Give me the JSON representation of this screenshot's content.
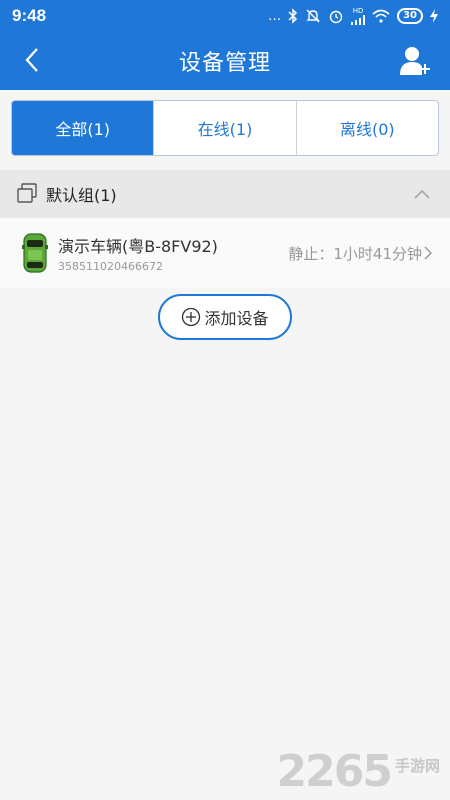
{
  "status_bar": {
    "time": "9:48",
    "dots": "…",
    "network_label": "HD",
    "battery": "30"
  },
  "nav": {
    "title": "设备管理",
    "back_icon": "chevron-left-icon",
    "add_user_icon": "add-user-icon"
  },
  "tabs": [
    {
      "label": "全部(1)",
      "active": true
    },
    {
      "label": "在线(1)",
      "active": false
    },
    {
      "label": "离线(0)",
      "active": false
    }
  ],
  "group": {
    "name": "默认组(1)",
    "icon": "group-icon",
    "collapse_icon": "chevron-up-icon"
  },
  "devices": [
    {
      "name": "演示车辆(粤B-8FV92)",
      "id": "358511020466672",
      "status": "静止：1小时41分钟",
      "icon": "car-icon"
    }
  ],
  "add_device": {
    "label": "添加设备",
    "icon": "plus-circle-icon"
  },
  "watermark": {
    "number": "2265",
    "text": "手游网"
  },
  "colors": {
    "primary": "#1f78d8",
    "background": "#f5f5f5",
    "group_bg": "#e8e8e8"
  }
}
